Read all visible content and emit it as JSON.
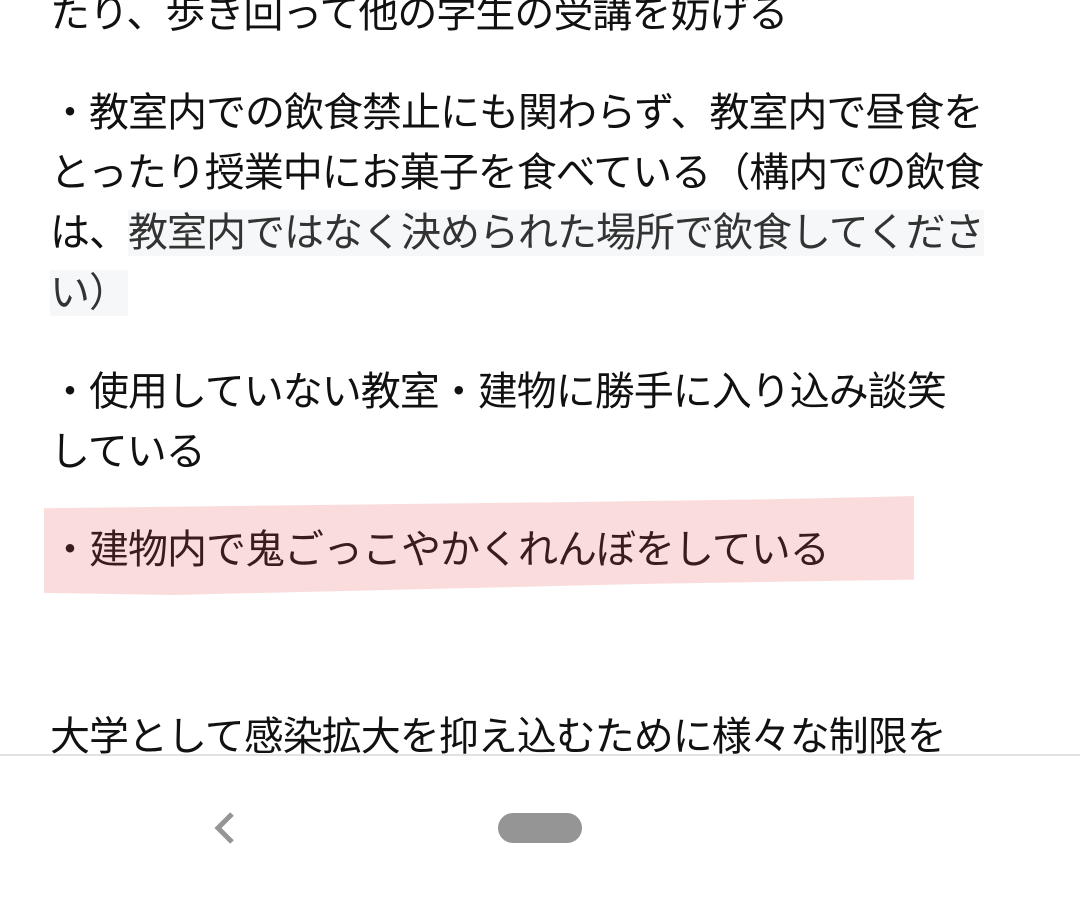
{
  "article": {
    "lines": [
      "たり、歩き回って他の学生の受講を妨げる",
      "・教室内での飲食禁止にも関わらず、教室内で昼食を",
      "とったり授業中にお菓子を食べている（構内での飲食",
      "は、",
      "教室内ではなく決められた場所で飲食してくださ",
      "い）",
      "・使用していない教室・建物に勝手に入り込み談笑",
      "している",
      "・建物内で鬼ごっこやかくれんぼをしている",
      "大学として感染拡大を抑え込むために様々な制限を"
    ]
  },
  "colors": {
    "marker_highlight": "#fbdcdc",
    "marker_text": "#3a1c1c",
    "soft_highlight": "#f5f7f9",
    "nav_icon": "#959595"
  },
  "navigation": {
    "back_icon": "chevron-left-icon",
    "home_icon": "home-pill-icon"
  }
}
